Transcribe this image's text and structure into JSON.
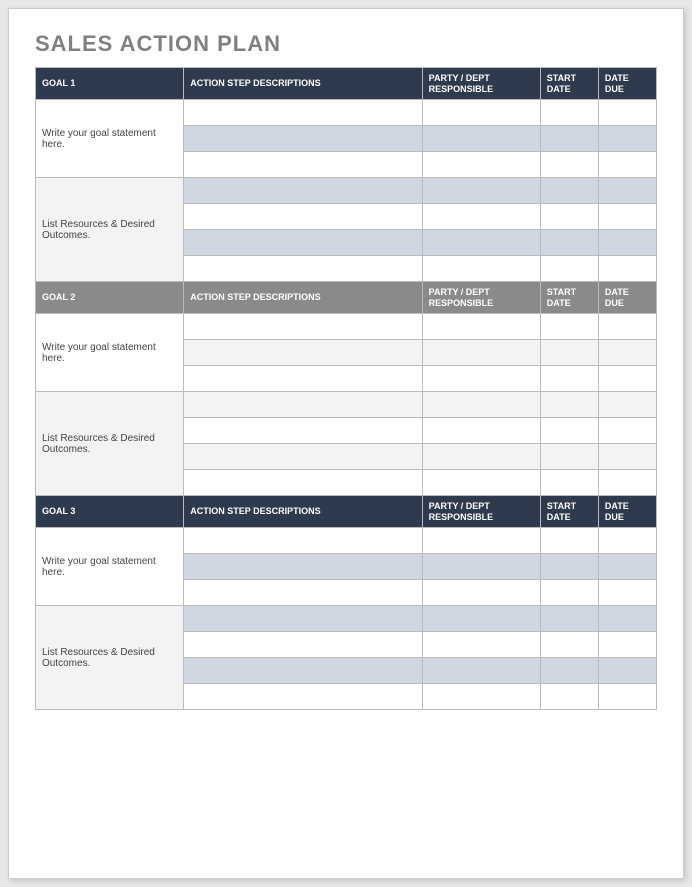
{
  "title": "SALES ACTION PLAN",
  "columns": {
    "action": "ACTION STEP DESCRIPTIONS",
    "party": "PARTY / DEPT RESPONSIBLE",
    "start": "START DATE",
    "due": "DATE DUE"
  },
  "goal_statement_prompt": "Write your goal statement here.",
  "resources_prompt": "List Resources & Desired Outcomes.",
  "sections": [
    {
      "label": "GOAL 1",
      "header_style": "dark"
    },
    {
      "label": "GOAL 2",
      "header_style": "grey"
    },
    {
      "label": "GOAL 3",
      "header_style": "dark"
    }
  ]
}
